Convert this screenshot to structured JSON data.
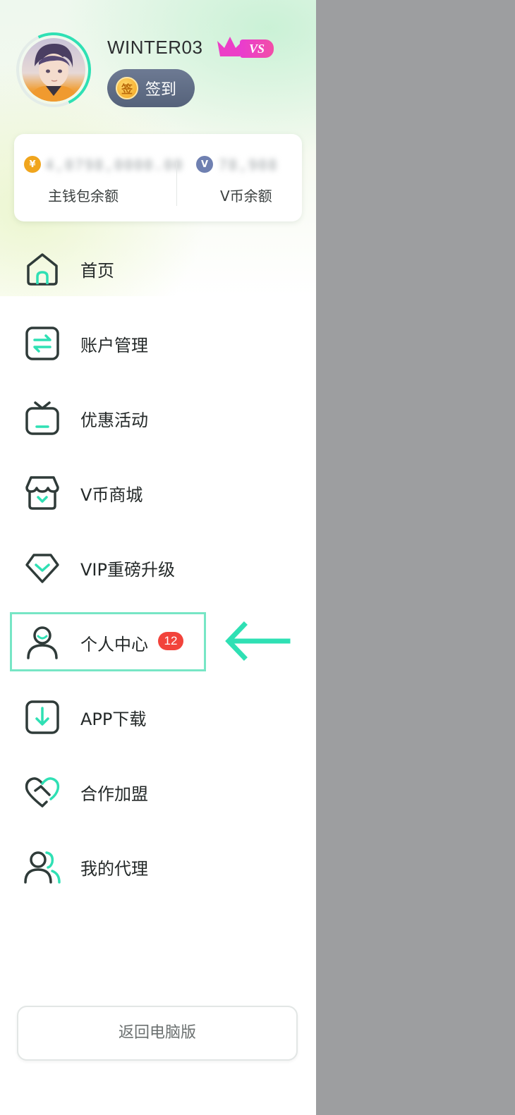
{
  "profile": {
    "username": "WINTER03",
    "vip_badge": "VS",
    "signin_label": "签到",
    "signin_coin_glyph": "签"
  },
  "wallet": {
    "main_balance_masked": "4,0798,0000.00",
    "main_label": "主钱包余额",
    "v_balance_masked": "78,908",
    "v_label": "V币余额",
    "main_coin_glyph": "¥",
    "v_coin_glyph": "V"
  },
  "menu": {
    "items": [
      {
        "label": "首页",
        "icon": "home-icon"
      },
      {
        "label": "账户管理",
        "icon": "transfer-icon"
      },
      {
        "label": "优惠活动",
        "icon": "gift-tv-icon"
      },
      {
        "label": "V币商城",
        "icon": "shop-icon"
      },
      {
        "label": "VIP重磅升级",
        "icon": "diamond-icon"
      },
      {
        "label": "个人中心",
        "icon": "user-icon",
        "badge": "12"
      },
      {
        "label": "APP下载",
        "icon": "download-icon"
      },
      {
        "label": "合作加盟",
        "icon": "handshake-heart-icon"
      },
      {
        "label": "我的代理",
        "icon": "users-icon"
      }
    ]
  },
  "footer": {
    "return_label": "返回电脑版"
  },
  "colors": {
    "accent": "#2fe0b4",
    "icon_stroke": "#2f3b39",
    "badge": "#f2433b",
    "vip": "#e93ccf",
    "overlay": "#9d9ea0"
  }
}
